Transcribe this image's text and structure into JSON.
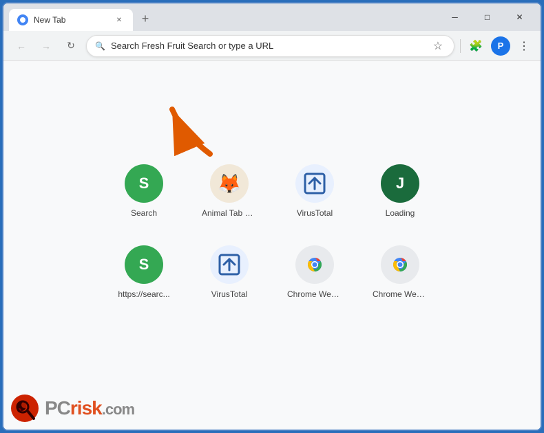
{
  "browser": {
    "tab": {
      "title": "New Tab",
      "favicon": "chrome-favicon"
    },
    "window_controls": {
      "minimize": "─",
      "maximize": "□",
      "close": "✕"
    },
    "nav": {
      "back": "←",
      "forward": "→",
      "reload": "↻",
      "address_placeholder": "Search Fresh Fruit Search or type a URL"
    },
    "toolbar": {
      "bookmark": "☆",
      "extensions": "🧩",
      "profile": "👤",
      "menu": "⋮"
    }
  },
  "shortcuts": {
    "row1": [
      {
        "id": "search",
        "label": "Search",
        "icon_type": "letter-s-green",
        "letter": "S"
      },
      {
        "id": "animal-tab",
        "label": "Animal Tab N...",
        "icon_type": "animal-fox"
      },
      {
        "id": "virustotal1",
        "label": "VirusTotal",
        "icon_type": "vt-arrow"
      },
      {
        "id": "loading",
        "label": "Loading",
        "icon_type": "letter-j-dark",
        "letter": "J"
      }
    ],
    "row2": [
      {
        "id": "https-search",
        "label": "https://searc...",
        "icon_type": "letter-s-green2",
        "letter": "S"
      },
      {
        "id": "virustotal2",
        "label": "VirusTotal",
        "icon_type": "vt-arrow2"
      },
      {
        "id": "chrome-web1",
        "label": "Chrome Web...",
        "icon_type": "chrome-logo"
      },
      {
        "id": "chrome-web2",
        "label": "Chrome Web _",
        "icon_type": "chrome-logo2"
      }
    ]
  },
  "watermark": {
    "text_pc": "PC",
    "text_risk": "risk",
    "text_domain": ".com"
  }
}
